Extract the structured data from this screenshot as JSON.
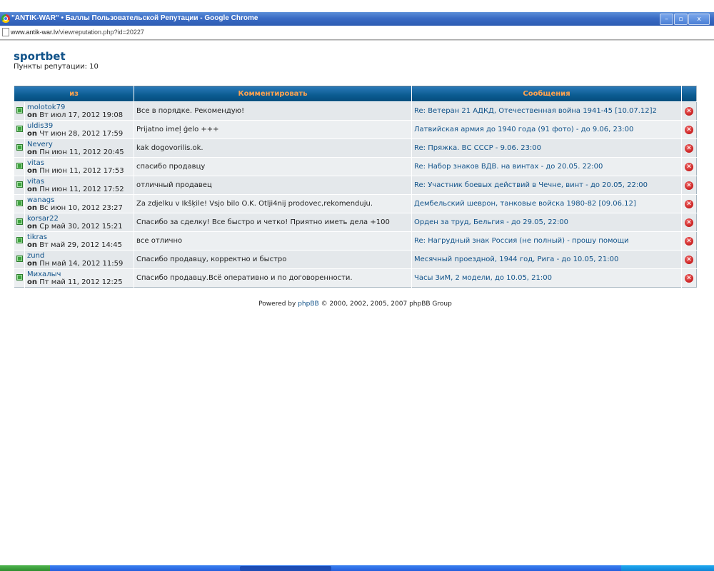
{
  "window": {
    "title": "\"ANTIK-WAR\" • Баллы Пользовательской Репутации - Google Chrome",
    "url_host": "www.antik-war.lv",
    "url_path": "/viewreputation.php?id=20227",
    "btn_minimize": "–",
    "btn_maximize": "▫",
    "btn_close": "x"
  },
  "page": {
    "username": "sportbet",
    "points_label": "Пункты репутации: 10"
  },
  "table": {
    "headers": {
      "from": "из",
      "comment": "Комментировать",
      "messages": "Сообщения"
    },
    "rows": [
      {
        "user": "molotok79",
        "on": "on",
        "date": "Вт июл 17, 2012 19:08",
        "comment": "Все в порядке. Рекомендую!",
        "message": "Re: Ветеран 21 АДКД, Отечественная война 1941-45 [10.07.12]2"
      },
      {
        "user": "uldis39",
        "on": "on",
        "date": "Чт июн 28, 2012 17:59",
        "comment": "Prijatno imeļ ģelo +++",
        "message": "Латвийская армия до 1940 года (91 фото) - до 9.06, 23:00"
      },
      {
        "user": "Nevery",
        "on": "on",
        "date": "Пн июн 11, 2012 20:45",
        "comment": "kak dogovorilis.ok.",
        "message": "Re: Пряжка. ВС СССР - 9.06. 23:00"
      },
      {
        "user": "vitas",
        "on": "on",
        "date": "Пн июн 11, 2012 17:53",
        "comment": "спасибо продавцу",
        "message": "Re: Набор знаков ВДВ. на винтах - до 20.05. 22:00"
      },
      {
        "user": "vitas",
        "on": "on",
        "date": "Пн июн 11, 2012 17:52",
        "comment": "отличный продавец",
        "message": "Re: Участник боевых действий в Чечне, винт - до 20.05, 22:00"
      },
      {
        "user": "wanags",
        "on": "on",
        "date": "Вс июн 10, 2012 23:27",
        "comment": "Za zdjelku v Ikšķile! Vsjo bilo O.K. Otlji4nij prodovec,rekomenduju.",
        "message": "Дембельский шеврон, танковые войска 1980-82 [09.06.12]"
      },
      {
        "user": "korsar22",
        "on": "on",
        "date": "Ср май 30, 2012 15:21",
        "comment": "Спасибо за сделку! Все быстро и четко! Приятно иметь дела +100",
        "message": "Орден за труд, Бельгия - до 29.05, 22:00"
      },
      {
        "user": "tikras",
        "on": "on",
        "date": "Вт май 29, 2012 14:45",
        "comment": "все отлично",
        "message": "Re: Нагрудный знак Россия (не полный) - прошу помощи"
      },
      {
        "user": "zund",
        "on": "on",
        "date": "Пн май 14, 2012 11:59",
        "comment": "Спасибо продавцу, корректно и быстро",
        "message": "Месячный проездной, 1944 год, Рига - до 10.05, 21:00"
      },
      {
        "user": "Михалыч",
        "on": "on",
        "date": "Пт май 11, 2012 12:25",
        "comment": "Спасибо продавцу.Всё оперативно и по договоренности.",
        "message": "Часы ЗиМ, 2 модели, до 10.05, 21:00"
      }
    ]
  },
  "footer": {
    "prefix": "Powered by ",
    "link": "phpBB",
    "suffix": " © 2000, 2002, 2005, 2007 phpBB Group"
  },
  "icons": {
    "status": "green-square-icon",
    "delete": "delete-x-icon",
    "delete_glyph": "✕"
  }
}
